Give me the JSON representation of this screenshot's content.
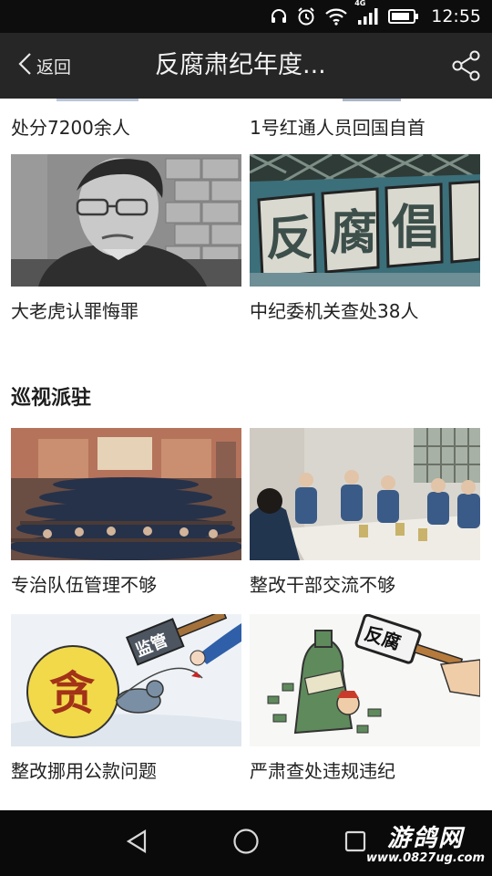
{
  "status_bar": {
    "time": "12:55",
    "network_type": "4G",
    "icons": [
      "headphones-icon",
      "alarm-icon",
      "wifi-icon",
      "signal-icon",
      "battery-icon"
    ]
  },
  "header": {
    "back_label": "返回",
    "title": "反腐肃纪年度...",
    "share_icon": "share-icon"
  },
  "content": {
    "partial_row": {
      "left_caption": "处分7200余人",
      "right_caption": "1号红通人员回国自首"
    },
    "row1": [
      {
        "caption": "大老虎认罪悔罪",
        "image": "man-in-courtroom-photo"
      },
      {
        "caption": "中纪委机关查处38人",
        "image": "anti-corruption-sign-photo"
      }
    ],
    "section_title": "巡视派驻",
    "row2": [
      {
        "caption": "专治队伍管理不够",
        "image": "police-meeting-hall-photo"
      },
      {
        "caption": "整改干部交流不够",
        "image": "officials-meeting-table-photo"
      }
    ],
    "row3": [
      {
        "caption": "整改挪用公款问题",
        "image": "supervision-hammer-cartoon",
        "cartoon_text": [
          "监管",
          "贪"
        ]
      },
      {
        "caption": "严肃查处违规违纪",
        "image": "anti-corruption-hammer-cartoon",
        "cartoon_text": [
          "反腐"
        ]
      }
    ]
  },
  "nav_bar": {
    "buttons": [
      "back-triangle-icon",
      "home-circle-icon",
      "recent-square-icon"
    ],
    "watermark_name": "游鸽网",
    "watermark_url": "www.0827ug.com"
  },
  "colors": {
    "status_bar_bg": "#0d0d0d",
    "header_bg": "#262626",
    "content_bg": "#ffffff",
    "text": "#222222",
    "nav_bar_bg": "#0a0a0a"
  }
}
